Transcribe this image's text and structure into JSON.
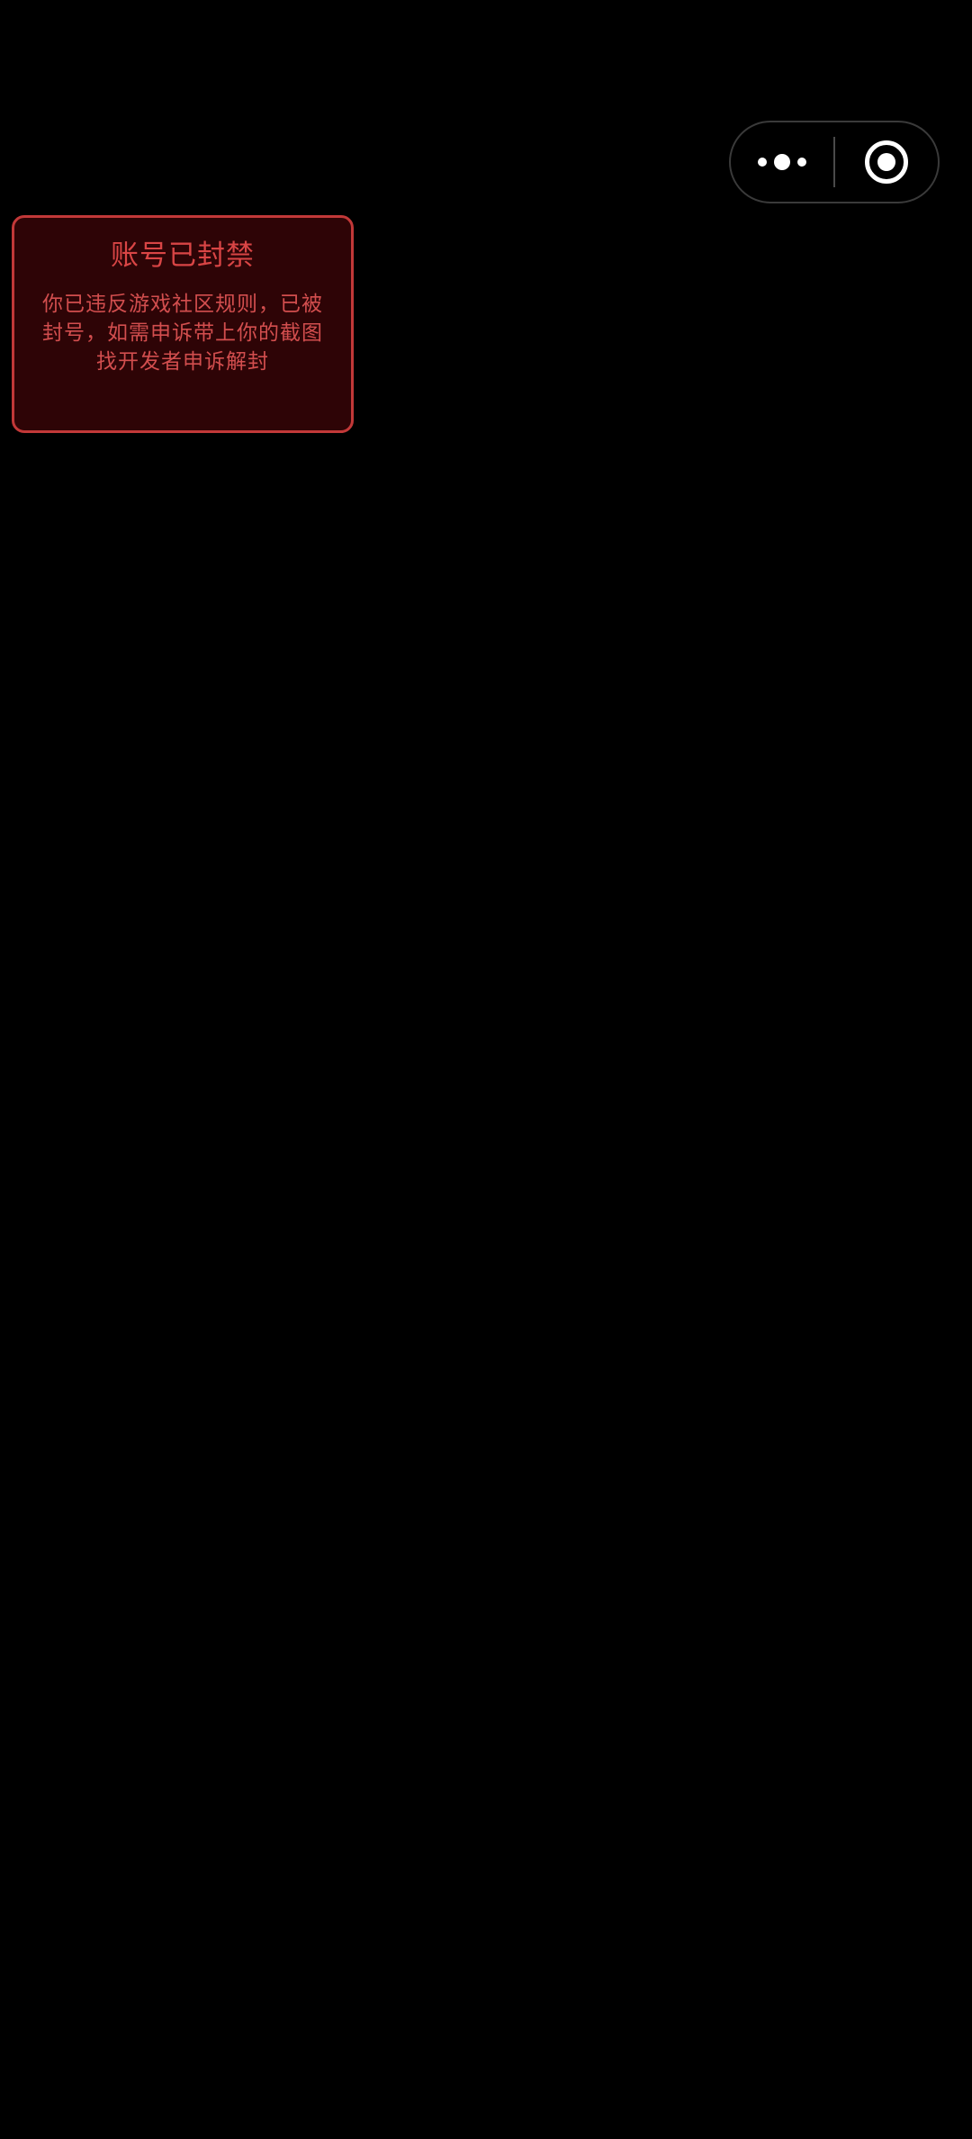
{
  "capsule": {
    "more_icon": "more-dots-icon",
    "close_icon": "close-target-icon"
  },
  "ban_notice": {
    "title": "账号已封禁",
    "message": "你已违反游戏社区规则，已被封号，如需申诉带上你的截图找开发者申诉解封"
  },
  "colors": {
    "background": "#000000",
    "card_background": "#2e0406",
    "card_border": "#c23838",
    "title_text": "#d94545",
    "message_text": "#d24e4e"
  }
}
